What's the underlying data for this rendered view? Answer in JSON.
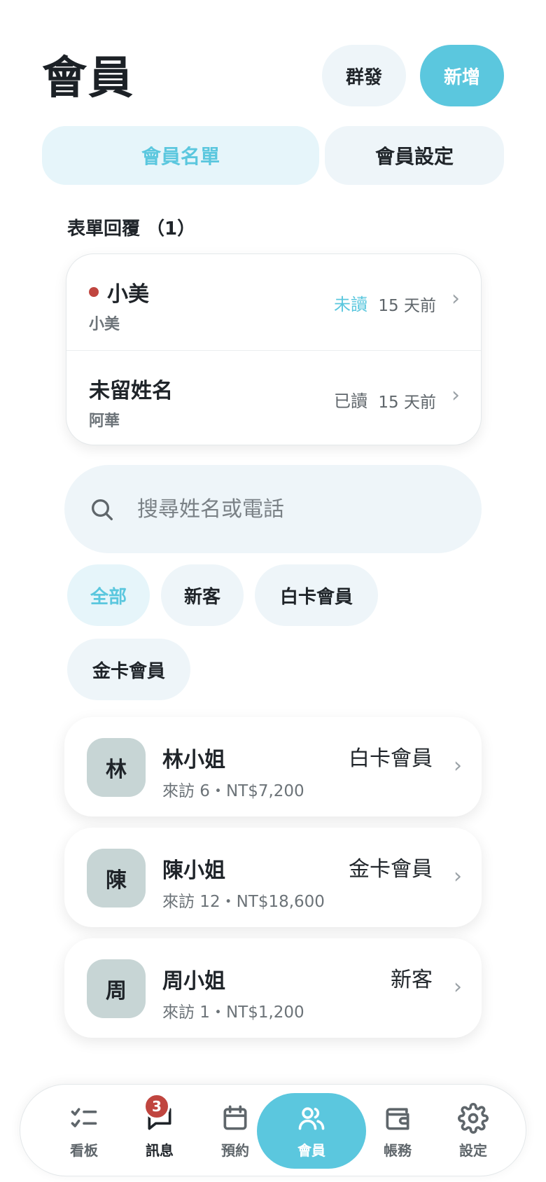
{
  "header": {
    "title": "會員",
    "broadcast_label": "群發",
    "add_label": "新增"
  },
  "tabs": [
    {
      "label": "會員名單",
      "active": true
    },
    {
      "label": "會員設定",
      "active": false
    }
  ],
  "form_replies": {
    "title": "表單回覆 （1）",
    "items": [
      {
        "name": "小美",
        "sub": "小美",
        "status": "未讀",
        "time": "15 天前",
        "unread": true
      },
      {
        "name": "未留姓名",
        "sub": "阿華",
        "status": "已讀",
        "time": "15 天前",
        "unread": false
      }
    ]
  },
  "search": {
    "placeholder": "搜尋姓名或電話",
    "value": ""
  },
  "filters": [
    {
      "label": "全部",
      "active": true
    },
    {
      "label": "新客",
      "active": false
    },
    {
      "label": "白卡會員",
      "active": false
    },
    {
      "label": "金卡會員",
      "active": false
    }
  ],
  "members": [
    {
      "initial": "林",
      "name": "林小姐",
      "meta": "來訪 6・NT$7,200",
      "tier": "白卡會員"
    },
    {
      "initial": "陳",
      "name": "陳小姐",
      "meta": "來訪 12・NT$18,600",
      "tier": "金卡會員"
    },
    {
      "initial": "周",
      "name": "周小姐",
      "meta": "來訪 1・NT$1,200",
      "tier": "新客"
    }
  ],
  "chevron": "›",
  "bottom_nav": {
    "items": [
      {
        "label": "看板",
        "icon": "checklist-icon"
      },
      {
        "label": "訊息",
        "icon": "chat-icon",
        "badge": "3"
      },
      {
        "label": "預約",
        "icon": "calendar-icon"
      },
      {
        "label": "會員",
        "icon": "users-icon",
        "current": true
      },
      {
        "label": "帳務",
        "icon": "wallet-icon"
      },
      {
        "label": "設定",
        "icon": "gear-icon"
      }
    ]
  },
  "colors": {
    "accent": "#5bc7de",
    "accent_soft": "#e6f5fa",
    "chip_bg": "#eef5f9",
    "unread_dot": "#c0453f",
    "avatar_bg": "#c7d5d5"
  }
}
